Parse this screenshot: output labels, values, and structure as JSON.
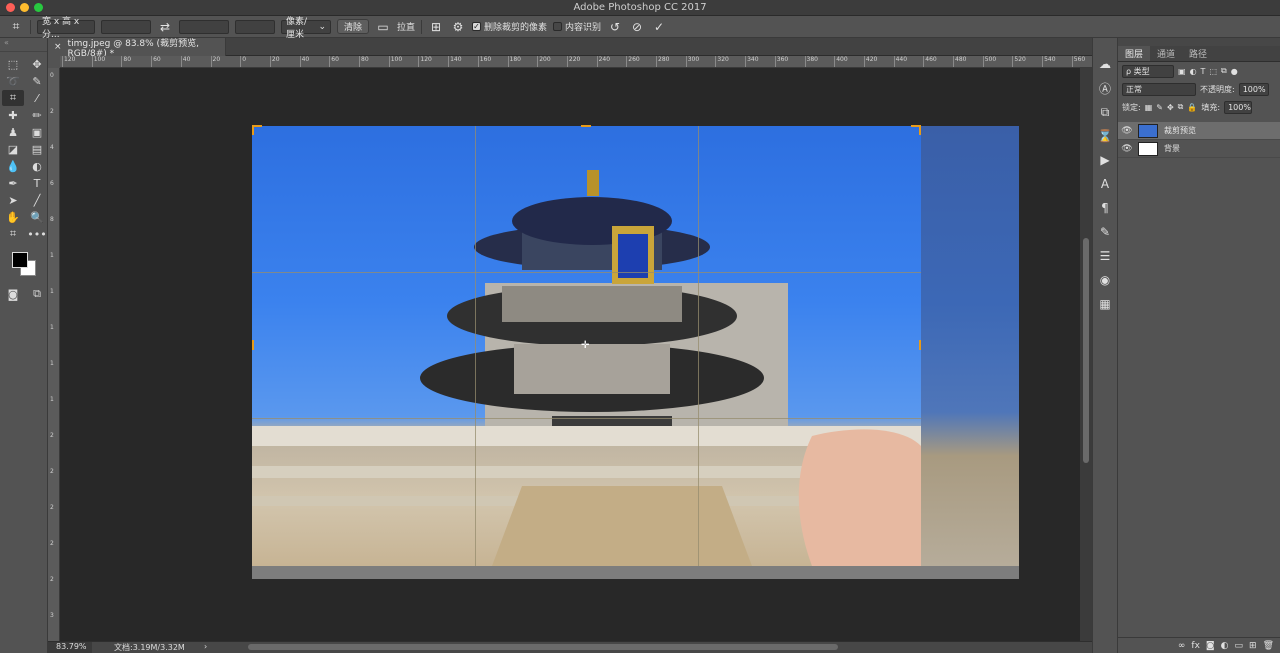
{
  "app": {
    "title": "Adobe Photoshop CC 2017",
    "traffic_lights": [
      "#fe5f57",
      "#febc2e",
      "#28c840"
    ]
  },
  "options_bar": {
    "ratio_dropdown": "宽 x 高 x 分...",
    "swap_icon": "swap-arrows-icon",
    "unit_dropdown": "像素/厘米",
    "clear_button": "清除",
    "straighten_label": "拉直",
    "delete_cropped_label": "删除裁剪的像素",
    "delete_cropped_checked": true,
    "content_aware_label": "内容识别",
    "content_aware_checked": false,
    "reset_icon": "undo-icon",
    "cancel_icon": "cancel-icon",
    "commit_icon": "check-icon"
  },
  "document": {
    "tab_title": "timg.jpeg @ 83.8% (裁剪预览, RGB/8#) *",
    "close_glyph": "×"
  },
  "ruler_h": [
    "120",
    "100",
    "80",
    "60",
    "40",
    "20",
    "0",
    "20",
    "40",
    "60",
    "80",
    "100",
    "120",
    "140",
    "160",
    "180",
    "200",
    "220",
    "240",
    "260",
    "280",
    "300",
    "320",
    "340",
    "360",
    "380",
    "400",
    "420",
    "440",
    "460",
    "480",
    "500",
    "520",
    "540",
    "560"
  ],
  "ruler_v": [
    "0",
    "2",
    "4",
    "6",
    "8",
    "1",
    "1",
    "1",
    "1",
    "1",
    "2",
    "2",
    "2",
    "2",
    "2",
    "3"
  ],
  "layers_panel": {
    "tabs": [
      "图层",
      "通道",
      "路径"
    ],
    "active_tab": 0,
    "filter_dropdown": "ρ 类型",
    "blend_mode": "正常",
    "opacity_label": "不透明度:",
    "opacity_value": "100%",
    "lock_label": "锁定:",
    "fill_label": "填充:",
    "fill_value": "100%",
    "layers": [
      {
        "name": "裁剪预览",
        "selected": true
      },
      {
        "name": "背景",
        "selected": false
      }
    ],
    "footer_icons": [
      "link-icon",
      "fx-icon",
      "mask-icon",
      "adjustment-icon",
      "folder-icon",
      "new-layer-icon",
      "trash-icon"
    ]
  },
  "status_bar": {
    "zoom": "83.79%",
    "doc_info": "文档:3.19M/3.32M",
    "arrow": "›"
  }
}
